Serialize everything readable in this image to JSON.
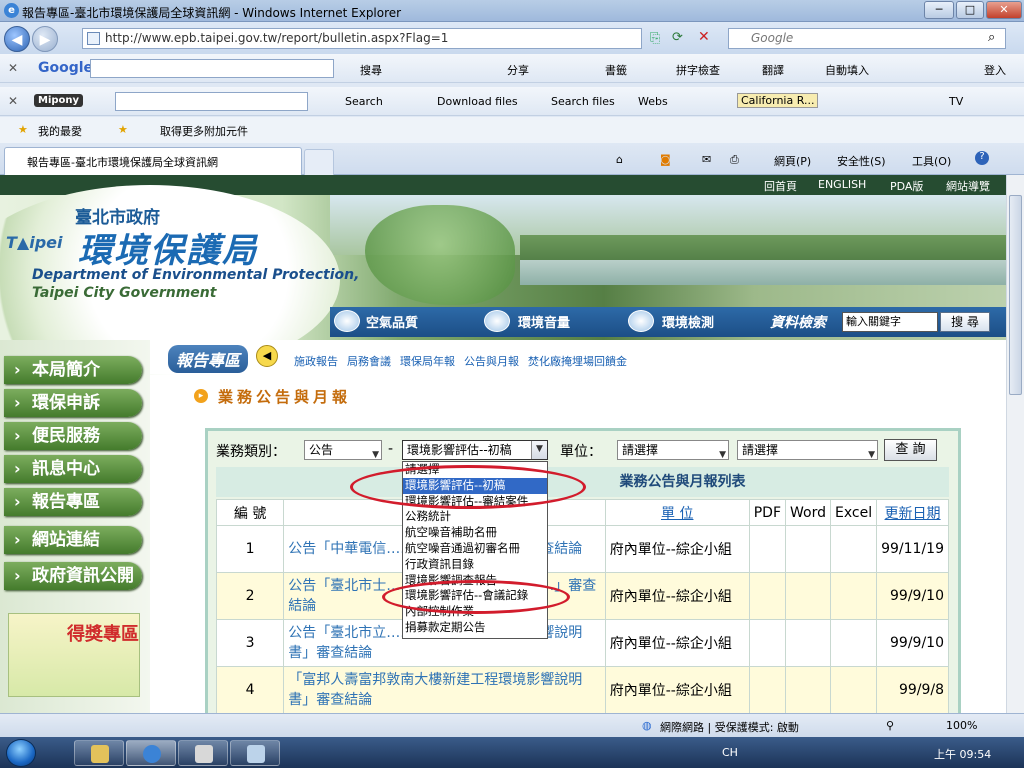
{
  "window": {
    "title": "報告專區-臺北市環境保護局全球資訊網 - Windows Internet Explorer",
    "url": "http://www.epb.taipei.gov.tw/report/bulletin.aspx?Flag=1",
    "search_placeholder": "Google"
  },
  "google_toolbar": {
    "brand": "Google",
    "search": "搜尋",
    "share": "分享",
    "bookmarks": "書籤",
    "spellcheck": "拼字檢查",
    "translate": "翻譯",
    "autofill": "自動填入",
    "signin": "登入"
  },
  "mipony_toolbar": {
    "brand": "Mipony",
    "search": "Search",
    "download": "Download files",
    "search_files": "Search files",
    "webs": "Webs",
    "radio": "California R...",
    "tv": "TV"
  },
  "favorites": {
    "fav": "我的最愛",
    "addons": "取得更多附加元件"
  },
  "tab": {
    "label": "報告專區-臺北市環境保護局全球資訊網"
  },
  "command_bar": {
    "page": "網頁(P)",
    "safety": "安全性(S)",
    "tools": "工具(O)"
  },
  "site": {
    "topnav": [
      "回首頁",
      "ENGLISH",
      "PDA版",
      "網站導覽"
    ],
    "city": "臺北市政府",
    "bureau": "環境保護局",
    "dept_en_1": "Department of Environmental Protection,",
    "dept_en_2": "Taipei City Government",
    "subnav": [
      "空氣品質",
      "環境音量",
      "環境檢測"
    ],
    "search_label": "資料檢索",
    "search_value": "輸入關鍵字",
    "search_button": "搜 尋",
    "sidebar": [
      "本局簡介",
      "環保申訴",
      "便民服務",
      "訊息中心",
      "報告專區",
      "網站連結",
      "政府資訊公開"
    ],
    "award": "得獎專區",
    "report_title": "報告專區",
    "report_links": [
      "施政報告",
      "局務會議",
      "環保局年報",
      "公告與月報",
      "焚化廠掩埋場回饋金"
    ],
    "section_title": "業務公告與月報"
  },
  "filters": {
    "category_label": "業務類別：",
    "category_value": "公告",
    "subtype_value": "環境影響評估--初稿",
    "unit_label": "單位：",
    "unit_value_1": "請選擇",
    "unit_value_2": "請選擇",
    "query_button": "查 詢"
  },
  "dropdown_options": [
    "請選擇",
    "環境影響評估--初稿",
    "環境影響評估--審結案件",
    "公務統計",
    "航空噪音補助名冊",
    "航空噪音通過初審名冊",
    "行政資訊目錄",
    "環境影響調查報告",
    "環境影響評估--會議記錄",
    "內部控制作業",
    "捐募款定期公告"
  ],
  "dropdown_highlighted": 1,
  "list": {
    "heading": "業務公告與月報列表",
    "columns": [
      "編 號",
      "",
      "單 位",
      "PDF",
      "Word",
      "Excel",
      "更新日期"
    ],
    "rows": [
      {
        "no": "1",
        "title": "公告「中華電信……環境影響說明書」審查結論",
        "unit": "府內單位--綜企小組",
        "date": "99/11/19"
      },
      {
        "no": "2",
        "title": "公告「臺北市士……地號住宅大樓新建……」審查結論",
        "unit": "府內單位--綜企小組",
        "date": "99/9/10"
      },
      {
        "no": "3",
        "title": "公告「臺北市立……（整）建計畫環境影響說明書」審查結論",
        "unit": "府內單位--綜企小組",
        "date": "99/9/10"
      },
      {
        "no": "4",
        "title": "「富邦人壽富邦敦南大樓新建工程環境影響說明書」審查結論",
        "unit": "府內單位--綜企小組",
        "date": "99/9/8"
      }
    ]
  },
  "status": {
    "zone": "網際網路 | 受保護模式: 啟動",
    "zoom": "100%"
  },
  "taskbar": {
    "lang": "CH",
    "clock": "上午 09:54"
  }
}
